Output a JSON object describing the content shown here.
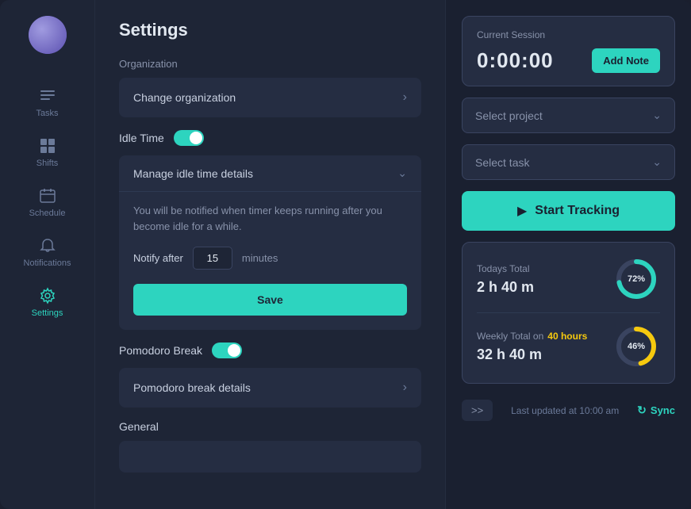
{
  "app": {
    "title": "Settings"
  },
  "sidebar": {
    "avatar_alt": "User Avatar",
    "items": [
      {
        "id": "tasks",
        "label": "Tasks",
        "icon": "tasks-icon",
        "active": false
      },
      {
        "id": "shifts",
        "label": "Shifts",
        "icon": "shifts-icon",
        "active": false
      },
      {
        "id": "schedule",
        "label": "Schedule",
        "icon": "schedule-icon",
        "active": false
      },
      {
        "id": "notifications",
        "label": "Notifications",
        "icon": "notifications-icon",
        "active": false
      },
      {
        "id": "settings",
        "label": "Settings",
        "icon": "settings-icon",
        "active": true
      }
    ]
  },
  "settings": {
    "title": "Settings",
    "organization_label": "Organization",
    "change_org_text": "Change organization",
    "idle_time_label": "Idle Time",
    "idle_details_label": "Manage idle time details",
    "idle_description": "You will be notified when timer keeps running after you become idle for a while.",
    "notify_after_label": "Notify after",
    "notify_minutes_value": "15",
    "notify_minutes_label": "minutes",
    "save_label": "Save",
    "pomodoro_label": "Pomodoro Break",
    "pomodoro_details_label": "Pomodoro break details",
    "general_label": "General"
  },
  "timer": {
    "session_label": "Current Session",
    "time": "0:00:00",
    "add_note_label": "Add Note",
    "select_project_placeholder": "Select project",
    "select_task_placeholder": "Select task",
    "start_tracking_label": "Start Tracking"
  },
  "stats": {
    "todays_total_label": "Todays Total",
    "todays_value": "2 h 40 m",
    "todays_percent": 72,
    "weekly_total_label": "Weekly Total on",
    "weekly_hours": "40 hours",
    "weekly_value": "32 h 40 m",
    "weekly_percent": 46
  },
  "footer": {
    "prev_icon": ">>",
    "last_updated_label": "Last updated at 10:00 am",
    "sync_label": "Sync"
  }
}
